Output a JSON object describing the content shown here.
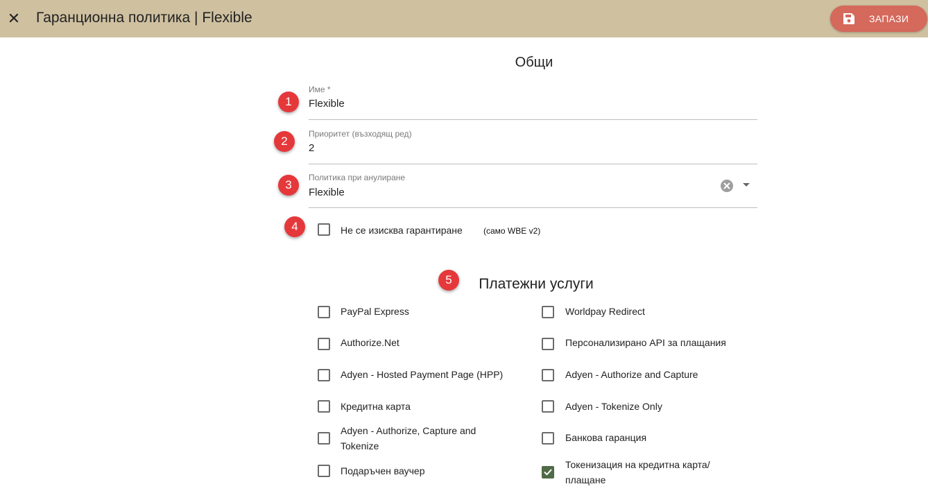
{
  "header": {
    "close_icon": "close-icon",
    "title": "Гаранционна политика | Flexible",
    "save_label": "ЗАПАЗИ",
    "save_icon": "floppy-disk-icon",
    "bar_color": "#cfc0a0",
    "save_color": "#d4695c"
  },
  "general": {
    "title": "Общи",
    "name_label": "Име *",
    "name_value": "Flexible",
    "priority_label": "Приоритет (възходящ ред)",
    "priority_value": "2",
    "cancel_policy_label": "Политика при анулиране",
    "cancel_policy_value": "Flexible",
    "no_guarantee_label": "Не се изисква гарантиране",
    "no_guarantee_note": "(само WBE v2)",
    "no_guarantee_checked": false
  },
  "badges": [
    "1",
    "2",
    "3",
    "4",
    "5"
  ],
  "payments": {
    "title": "Платежни услуги",
    "left": [
      {
        "label": "PayPal Express",
        "checked": false
      },
      {
        "label": "Authorize.Net",
        "checked": false
      },
      {
        "label": "Adyen - Hosted Payment Page (HPP)",
        "checked": false
      },
      {
        "label": "Кредитна карта",
        "checked": false
      },
      {
        "label": "Adyen - Authorize, Capture and Tokenize",
        "checked": false
      },
      {
        "label": "Подаръчен ваучер",
        "checked": false
      }
    ],
    "right": [
      {
        "label": "Worldpay Redirect",
        "checked": false
      },
      {
        "label": "Персонализирано API за плащания",
        "checked": false
      },
      {
        "label": "Adyen - Authorize and Capture",
        "checked": false
      },
      {
        "label": "Adyen - Tokenize Only",
        "checked": false
      },
      {
        "label": "Банкова гаранция",
        "checked": false
      },
      {
        "label": "Токенизация на кредитна карта/ плащане",
        "checked": true
      }
    ]
  },
  "colors": {
    "badge": "#e5383b",
    "checkbox_checked": "#4f6b47"
  }
}
